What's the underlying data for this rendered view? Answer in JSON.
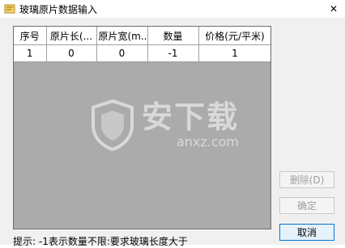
{
  "window": {
    "title": "玻璃原片数据输入",
    "close_symbol": "✕"
  },
  "grid": {
    "columns": [
      "序号",
      "原片长(...",
      "原片宽(m...",
      "数量",
      "价格(元/平米)"
    ],
    "rows": [
      [
        "1",
        "0",
        "0",
        "-1",
        "1"
      ]
    ]
  },
  "watermark": {
    "cn": "安下载",
    "en": "anxz.com"
  },
  "buttons": {
    "delete": "删除(D)",
    "confirm": "确定",
    "cancel": "取消"
  },
  "hint": "提示: -1表示数量不限:要求玻璃长度大于",
  "colors": {
    "grid_background": "#ababab",
    "dialog_background": "#f0f0f0"
  }
}
